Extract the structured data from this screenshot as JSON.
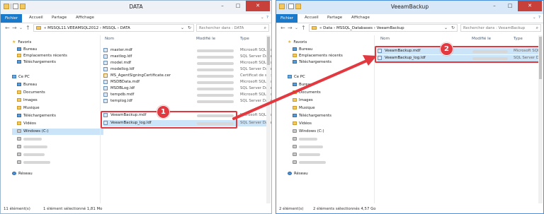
{
  "window_left": {
    "title": "DATA",
    "ribbon": {
      "file": "Fichier",
      "home": "Accueil",
      "share": "Partage",
      "view": "Affichage"
    },
    "address": {
      "crumbs": [
        "MSSQL11.VEEAMSQL2012",
        "MSSQL",
        "DATA"
      ]
    },
    "search": {
      "placeholder": "Rechercher dans : DATA"
    },
    "nav": {
      "favorites": "Favoris",
      "fav_items": [
        "Bureau",
        "Emplacements récents",
        "Téléchargements"
      ],
      "pc": "Ce PC",
      "pc_items": [
        "Bureau",
        "Documents",
        "Images",
        "Musique",
        "Téléchargements",
        "Vidéos",
        "Windows (C:)"
      ],
      "network": "Réseau"
    },
    "columns": {
      "name": "Nom",
      "modified": "Modifié le",
      "type": "Type"
    },
    "files": [
      {
        "name": "master.mdf",
        "type": "Microsoft SQL Serv"
      },
      {
        "name": "mastlog.ldf",
        "type": "SQL Server Databa"
      },
      {
        "name": "model.mdf",
        "type": "Microsoft SQL Serv"
      },
      {
        "name": "modellog.ldf",
        "type": "SQL Server Databa"
      },
      {
        "name": "MS_AgentSigningCertificate.cer",
        "type": "Certificat de sécu"
      },
      {
        "name": "MSDBData.mdf",
        "type": "Microsoft SQL Serv"
      },
      {
        "name": "MSDBLog.ldf",
        "type": "SQL Server Databa"
      },
      {
        "name": "tempdb.mdf",
        "type": "Microsoft SQL Serv"
      },
      {
        "name": "templog.ldf",
        "type": "SQL Server Databa"
      },
      {
        "name": "VeeamBackup.mdf",
        "type": "Microsoft SQL Serv"
      },
      {
        "name": "VeeamBackup_log.ldf",
        "type": "SQL Server Databa"
      }
    ],
    "status": {
      "count": "11 élément(s)",
      "selection": "1 élément sélectionné  1,81 Mo"
    },
    "badge": "1"
  },
  "window_right": {
    "title": "VeeamBackup",
    "ribbon": {
      "file": "Fichier",
      "home": "Accueil",
      "share": "Partage",
      "view": "Affichage"
    },
    "address": {
      "crumbs": [
        "Data",
        "MSSQL_Databases",
        "VeeamBackup"
      ]
    },
    "search": {
      "placeholder": "Rechercher dans : VeeamBackup"
    },
    "nav": {
      "favorites": "Favoris",
      "fav_items": [
        "Bureau",
        "Emplacements récents",
        "Téléchargements"
      ],
      "pc": "Ce PC",
      "pc_items": [
        "Bureau",
        "Documents",
        "Images",
        "Musique",
        "Téléchargements",
        "Vidéos",
        "Windows (C:)"
      ],
      "network": "Réseau"
    },
    "columns": {
      "name": "Nom",
      "modified": "Modifié le",
      "type": "Type"
    },
    "files": [
      {
        "name": "VeeamBackup.mdf",
        "type": "Microsoft SQL"
      },
      {
        "name": "VeeamBackup_log.ldf",
        "type": "SQL Server D"
      }
    ],
    "status": {
      "count": "2 élément(s)",
      "selection": "2 éléments sélectionnés  4,57 Go"
    },
    "badge": "2"
  },
  "colors": {
    "highlight": "#e2383f",
    "accent": "#1979ca",
    "selection": "#cce4f7"
  }
}
